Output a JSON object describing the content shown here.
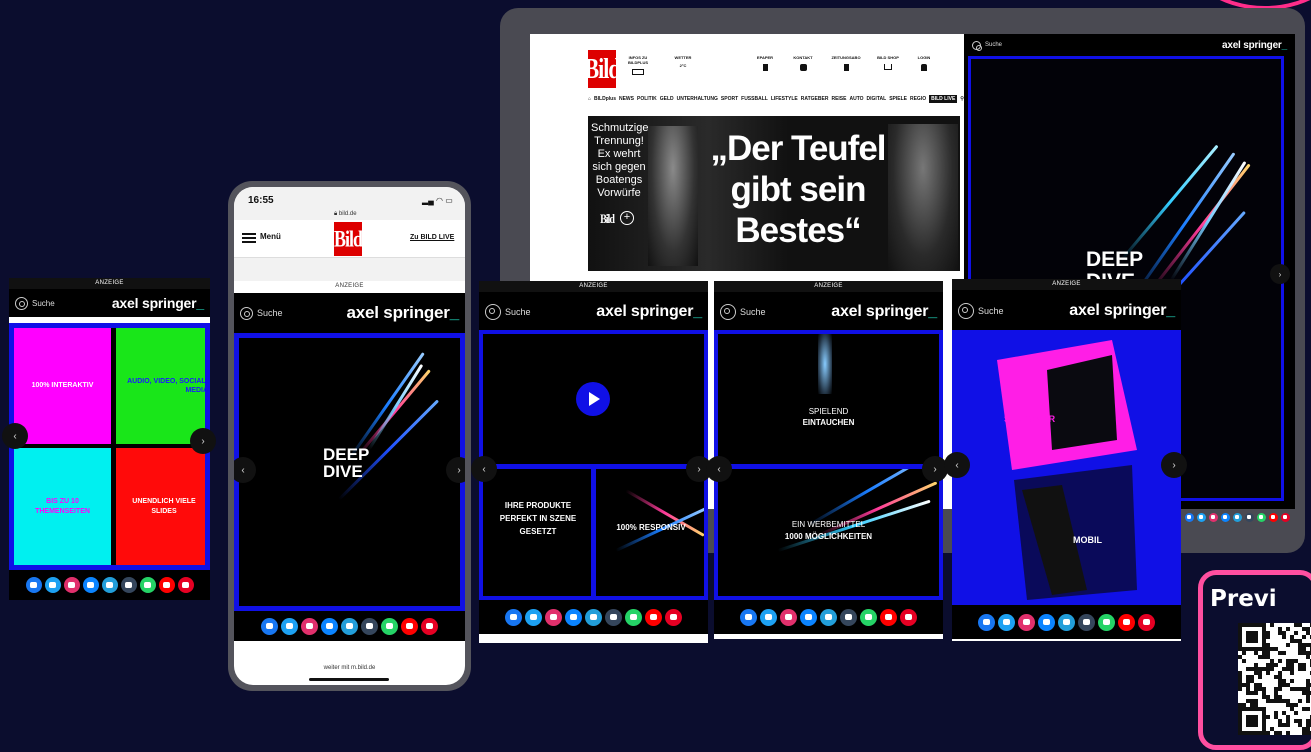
{
  "desktop": {
    "bild_logo": "Bild",
    "topnav": [
      {
        "label": "INFOS ZU BILDPLUS"
      },
      {
        "label": "WETTER",
        "value": "2°C"
      },
      {
        "label": "EPAPER"
      },
      {
        "label": "KONTAKT"
      },
      {
        "label": "ZEITUNGSABO"
      },
      {
        "label": "BILD SHOP"
      },
      {
        "label": "LOGIN"
      }
    ],
    "menu": [
      "BILDplus",
      "NEWS",
      "POLITIK",
      "GELD",
      "UNTERHALTUNG",
      "SPORT",
      "FUSSBALL",
      "LIFESTYLE",
      "RATGEBER",
      "REISE",
      "AUTO",
      "DIGITAL",
      "SPIELE",
      "REGIO",
      "BILD LIVE"
    ],
    "teaser": {
      "kicker": "Schmutzige Trennung! Ex wehrt sich gegen Boatengs Vorwürfe",
      "headline_1": "„Der Teufel",
      "headline_2": "gibt sein",
      "headline_3": "Bestes“"
    },
    "right_ad": {
      "search": "Suche",
      "brand": "axel springer",
      "title_1": "DEEP",
      "title_2": "DIVE"
    }
  },
  "phone": {
    "time": "16:55",
    "url": "bild.de",
    "menu_label": "Menü",
    "bild_logo": "Bild",
    "live_link": "Zu BILD LIVE",
    "ad_label": "ANZEIGE",
    "search": "Suche",
    "brand": "axel springer",
    "title_1": "DEEP",
    "title_2": "DIVE",
    "footer": "weiter mit m.bild.de"
  },
  "ads": {
    "label": "ANZEIGE",
    "search": "Suche",
    "brand": "axel springer",
    "panel1": {
      "tiles": [
        "100% INTERAKTIV",
        "AUDIO, VIDEO, SOCIAL- MEDIA",
        "BIS ZU 10 THEMENSEITEN",
        "UNENDLICH VIELE SLIDES"
      ],
      "colors": [
        "#ff00ff",
        "#19e619",
        "#00f0f0",
        "#ff0a0a"
      ]
    },
    "panel3": {
      "left_text": "IHRE PRODUKTE PERFEKT IN SZENE GESETZT",
      "right_text": "100% RESPONSIV"
    },
    "panel4": {
      "top_1": "SPIELEND",
      "top_2": "EINTAUCHEN",
      "bottom_1": "EIN WERBEMITTEL",
      "bottom_2": "1000 MÖGLICHKEITEN"
    },
    "panel5": {
      "stationaer": "STATIONÄR",
      "mobil": "MOBIL"
    }
  },
  "social_colors": [
    "#1877f2",
    "#1da1f2",
    "#e1306c",
    "#0b84ff",
    "#229ed9",
    "#35465c",
    "#25d366",
    "#ff0000",
    "#e60023"
  ],
  "preview": {
    "title": "Previ"
  }
}
